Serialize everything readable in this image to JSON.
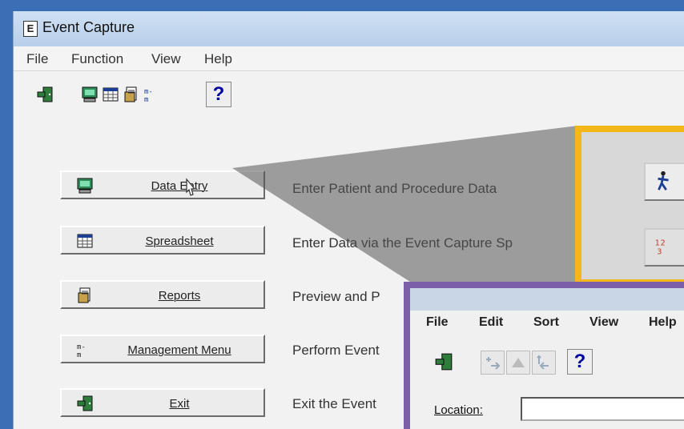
{
  "window": {
    "title": "Event Capture",
    "app_icon_letter": "E"
  },
  "menu": [
    "File",
    "Function",
    "View",
    "Help"
  ],
  "toolbar": {
    "icons": [
      "exit-door-icon",
      "computer-icon",
      "spreadsheet-icon",
      "reports-icon",
      "management-icon"
    ],
    "help_label": "?"
  },
  "buttons": [
    {
      "label": "Data Entry",
      "icon": "computer-icon",
      "description": "Enter Patient and Procedure Data"
    },
    {
      "label": "Spreadsheet",
      "icon": "spreadsheet-icon",
      "description": "Enter Data via the Event Capture Sp"
    },
    {
      "label": "Reports",
      "icon": "reports-icon",
      "description": "Preview and P"
    },
    {
      "label": "Management Menu",
      "icon": "management-icon",
      "description": "Perform Event"
    },
    {
      "label": "Exit",
      "icon": "exit-door-icon",
      "description": "Exit the Event"
    }
  ],
  "inset_dialog": {
    "menu": [
      "File",
      "Edit",
      "Sort",
      "View",
      "Help"
    ],
    "help_label": "?",
    "location_label": "Location:",
    "location_value": ""
  },
  "colors": {
    "yellow_frame": "#f2b818",
    "purple_frame": "#7b5fa8",
    "title_bar": "#b8cfea"
  }
}
